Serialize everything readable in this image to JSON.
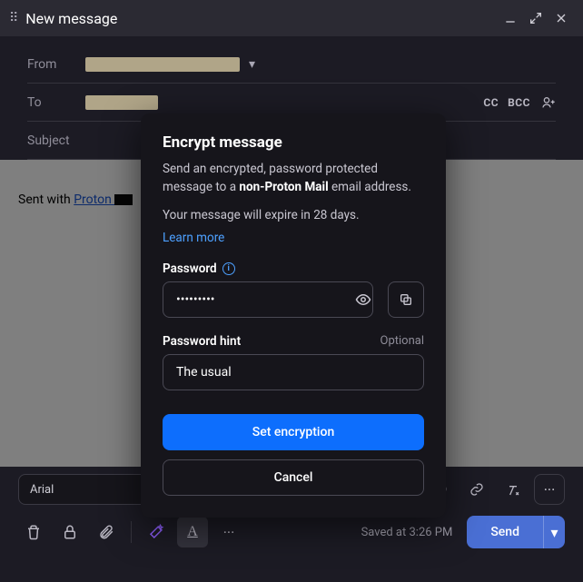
{
  "titlebar": {
    "title": "New message"
  },
  "compose": {
    "from_label": "From",
    "to_label": "To",
    "cc_label": "CC",
    "bcc_label": "BCC",
    "subject_placeholder": "Subject"
  },
  "body": {
    "sent_with": "Sent with ",
    "link_text": "Proton "
  },
  "toolbar": {
    "font": "Arial",
    "quote_glyph": "❙⁹⁹"
  },
  "bottombar": {
    "saved": "Saved at 3:26 PM",
    "send_label": "Send",
    "more_glyph": "···"
  },
  "modal": {
    "title": "Encrypt message",
    "desc_before": "Send an encrypted, password protected message to a ",
    "desc_bold": "non-Proton Mail",
    "desc_after": " email address.",
    "expire": "Your message will expire in 28 days.",
    "learn": "Learn more",
    "password_label": "Password",
    "password_value": "•••••••••",
    "hint_label": "Password hint",
    "optional": "Optional",
    "hint_value": "The usual",
    "set_btn": "Set encryption",
    "cancel_btn": "Cancel"
  }
}
